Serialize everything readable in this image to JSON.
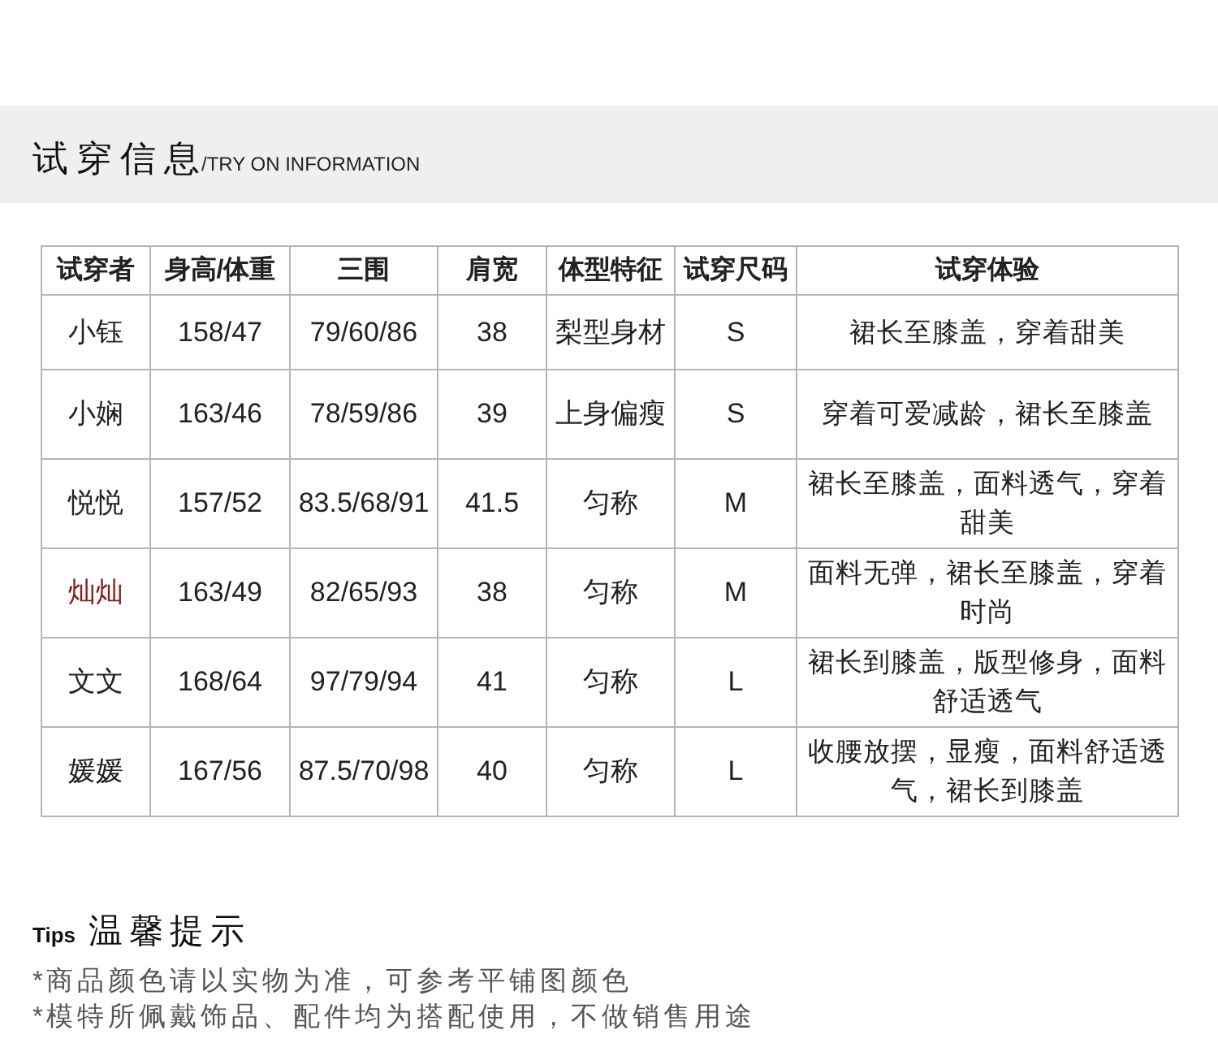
{
  "header": {
    "title": "试穿信息",
    "subtitle": "/TRY ON INFORMATION"
  },
  "table": {
    "columns": [
      "试穿者",
      "身高/体重",
      "三围",
      "肩宽",
      "体型特征",
      "试穿尺码",
      "试穿体验"
    ],
    "rows": [
      {
        "color": "#222222",
        "cells": [
          "小钰",
          "158/47",
          "79/60/86",
          "38",
          "梨型身材",
          "S",
          "裙长至膝盖，穿着甜美"
        ]
      },
      {
        "color": "#222222",
        "cells": [
          "小娴",
          "163/46",
          "78/59/86",
          "39",
          "上身偏瘦",
          "S",
          "穿着可爱减龄，裙长至膝盖"
        ]
      },
      {
        "color": "#222222",
        "cells": [
          "悦悦",
          "157/52",
          "83.5/68/91",
          "41.5",
          "匀称",
          "M",
          "裙长至膝盖，面料透气，穿着甜美"
        ]
      },
      {
        "color": "#8b1a1a",
        "cells": [
          "灿灿",
          "163/49",
          "82/65/93",
          "38",
          "匀称",
          "M",
          "面料无弹，裙长至膝盖，穿着时尚"
        ]
      },
      {
        "color": "#222222",
        "cells": [
          "文文",
          "168/64",
          "97/79/94",
          "41",
          "匀称",
          "L",
          "裙长到膝盖，版型修身，面料舒适透气"
        ]
      },
      {
        "color": "#222222",
        "cells": [
          "媛媛",
          "167/56",
          "87.5/70/98",
          "40",
          "匀称",
          "L",
          "收腰放摆，显瘦，面料舒适透气，裙长到膝盖"
        ]
      }
    ]
  },
  "tips": {
    "label": "Tips",
    "title": "温馨提示",
    "lines": [
      "*商品颜色请以实物为准，可参考平铺图颜色",
      "*模特所佩戴饰品、配件均为搭配使用，不做销售用途"
    ]
  }
}
